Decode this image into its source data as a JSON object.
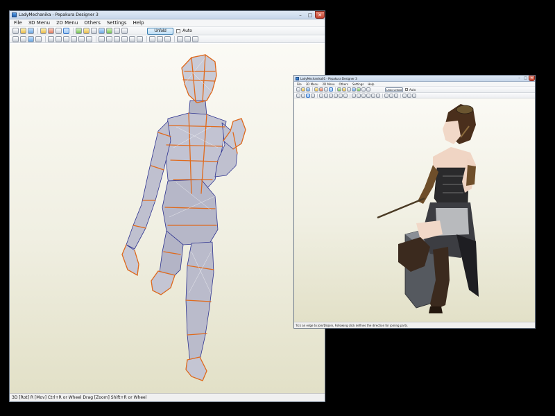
{
  "window_main": {
    "title": "LadyMechanika - Pepakura Designer 3",
    "menu": [
      "File",
      "3D Menu",
      "2D Menu",
      "Others",
      "Settings",
      "Help"
    ],
    "unfold_label": "Unfold",
    "auto_label": "Auto",
    "auto_checked": false,
    "status": "3D [Rot] R [Mov] Ctrl+R or Wheel Drag [Zoom] Shift+R or Wheel",
    "model_view": "wireframe-edges",
    "edge_color": "#e06a1c",
    "fold_line_color": "#3b3f9e"
  },
  "window_second": {
    "title": "LadyMechanika01 - Pepakura Designer 3",
    "menu": [
      "File",
      "3D Menu",
      "2D Menu",
      "Others",
      "Settings",
      "Help"
    ],
    "unfold_label": "Undo Unfold",
    "auto_label": "Auto",
    "auto_checked": false,
    "status": "Tick an edge to Join/Disjoin, Following click defines the direction for joining parts.",
    "model_view": "textured"
  },
  "colors": {
    "background": "#000000",
    "titlebar": "#c6d6ea",
    "viewport_top": "#fbfaf5",
    "viewport_bottom": "#e2e0c7"
  }
}
